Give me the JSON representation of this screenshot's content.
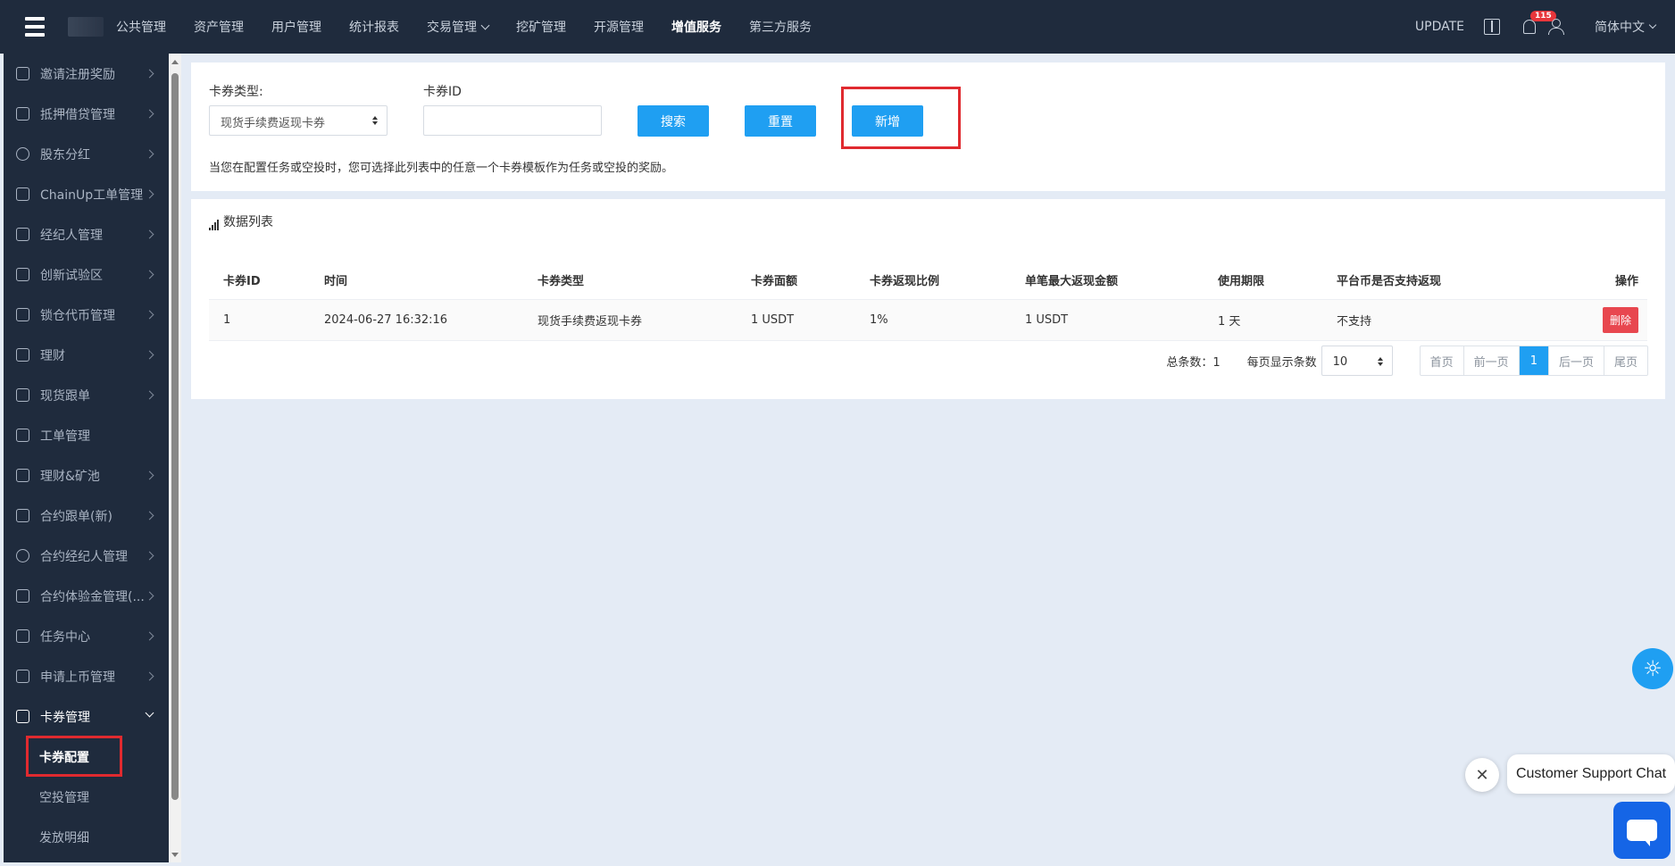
{
  "topnav": {
    "items": [
      "公共管理",
      "资产管理",
      "用户管理",
      "统计报表",
      "交易管理",
      "挖矿管理",
      "开源管理",
      "增值服务",
      "第三方服务"
    ],
    "update_label": "UPDATE",
    "notification_count": "115",
    "language": "简体中文"
  },
  "sidebar": {
    "items": [
      "邀请注册奖励",
      "抵押借贷管理",
      "股东分红",
      "ChainUp工单管理",
      "经纪人管理",
      "创新试验区",
      "锁仓代币管理",
      "理财",
      "现货跟单",
      "工单管理",
      "理财&矿池",
      "合约跟单(新)",
      "合约经纪人管理",
      "合约体验金管理(...",
      "任务中心",
      "申请上币管理",
      "卡券管理"
    ],
    "sub_items": [
      "卡券配置",
      "空投管理",
      "发放明细"
    ]
  },
  "filter": {
    "type_label": "卡券类型:",
    "type_value": "现货手续费返现卡券",
    "id_label": "卡券ID",
    "id_value": "",
    "search_label": "搜索",
    "reset_label": "重置",
    "add_label": "新增",
    "hint": "当您在配置任务或空投时，您可选择此列表中的任意一个卡券模板作为任务或空投的奖励。"
  },
  "table": {
    "title": "数据列表",
    "headers": [
      "卡券ID",
      "时间",
      "卡券类型",
      "卡券面额",
      "卡券返现比例",
      "单笔最大返现金额",
      "使用期限",
      "平台币是否支持返现",
      "操作"
    ],
    "rows": [
      [
        "1",
        "2024-06-27 16:32:16",
        "现货手续费返现卡券",
        "1 USDT",
        "1%",
        "1 USDT",
        "1 天",
        "不支持",
        "删除"
      ]
    ]
  },
  "pagination": {
    "total_label": "总条数：1",
    "page_size_label": "每页显示条数",
    "page_size": "10",
    "first": "首页",
    "prev": "前一页",
    "current": "1",
    "next": "后一页",
    "last": "尾页"
  },
  "chat": {
    "bubble_text": "Customer Support Chat",
    "close_glyph": "✕"
  },
  "colors": {
    "accent": "#1f9ff2",
    "nav_bg": "#1f2b3d",
    "danger": "#e8474f",
    "highlight": "#e02a2f"
  }
}
